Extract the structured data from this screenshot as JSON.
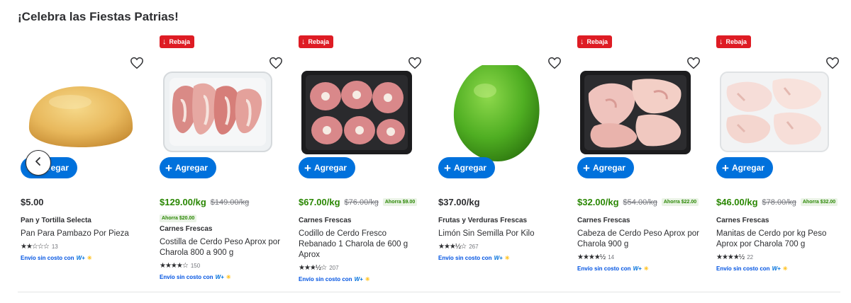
{
  "section": {
    "title": "¡Celebra las Fiestas Patrias!"
  },
  "common": {
    "add_label": "Agregar",
    "sale_badge": "Rebaja",
    "shipping_text": "Envío sin costo con",
    "plus_brand": "W+",
    "icons": {
      "favorite": "heart-outline-icon",
      "prev": "chevron-left-icon",
      "sale": "arrow-down-icon",
      "add": "plus-icon"
    }
  },
  "colors": {
    "blue": "#0071dc",
    "sale_red": "#de1c24",
    "sale_green": "#2a8703",
    "spark": "#ffc220"
  },
  "products": [
    {
      "badge": false,
      "price": "$5.00",
      "was": "",
      "save": "",
      "brand": "Pan y Tortilla Selecta",
      "name": "Pan Para Pambazo Por Pieza",
      "stars": "★★☆☆☆",
      "rating": 2,
      "reviews": "13",
      "image": "bread-roll"
    },
    {
      "badge": true,
      "price": "$129.00/kg",
      "was": "$149.00/kg",
      "save": "Ahorra $20.00",
      "brand": "Carnes Frescas",
      "name": "Costilla de Cerdo Peso Aprox por Charola 800 a 900 g",
      "stars": "★★★★☆",
      "rating": 4,
      "reviews": "150",
      "image": "pork-ribs-tray"
    },
    {
      "badge": true,
      "price": "$67.00/kg",
      "was": "$76.00/kg",
      "save": "Ahorra $9.00",
      "brand": "Carnes Frescas",
      "name": "Codillo de Cerdo Fresco Rebanado 1 Charola de 600 g Aprox",
      "stars": "★★★½☆",
      "rating": 3.5,
      "reviews": "207",
      "image": "pork-shank-slices"
    },
    {
      "badge": false,
      "price": "$37.00/kg",
      "was": "",
      "save": "",
      "brand": "Frutas y Verduras Frescas",
      "name": "Limón Sin Semilla Por Kilo",
      "stars": "★★★½☆",
      "rating": 3.5,
      "reviews": "267",
      "image": "lime"
    },
    {
      "badge": true,
      "price": "$32.00/kg",
      "was": "$54.00/kg",
      "save": "Ahorra $22.00",
      "brand": "Carnes Frescas",
      "name": "Cabeza de Cerdo Peso Aprox por Charola 900 g",
      "stars": "★★★★½",
      "rating": 4.5,
      "reviews": "14",
      "image": "pork-head-tray"
    },
    {
      "badge": true,
      "price": "$46.00/kg",
      "was": "$78.00/kg",
      "save": "Ahorra $32.00",
      "brand": "Carnes Frescas",
      "name": "Manitas de Cerdo por kg Peso Aprox por Charola 700 g",
      "stars": "★★★★½",
      "rating": 4.5,
      "reviews": "22",
      "image": "pork-feet-tray"
    }
  ]
}
